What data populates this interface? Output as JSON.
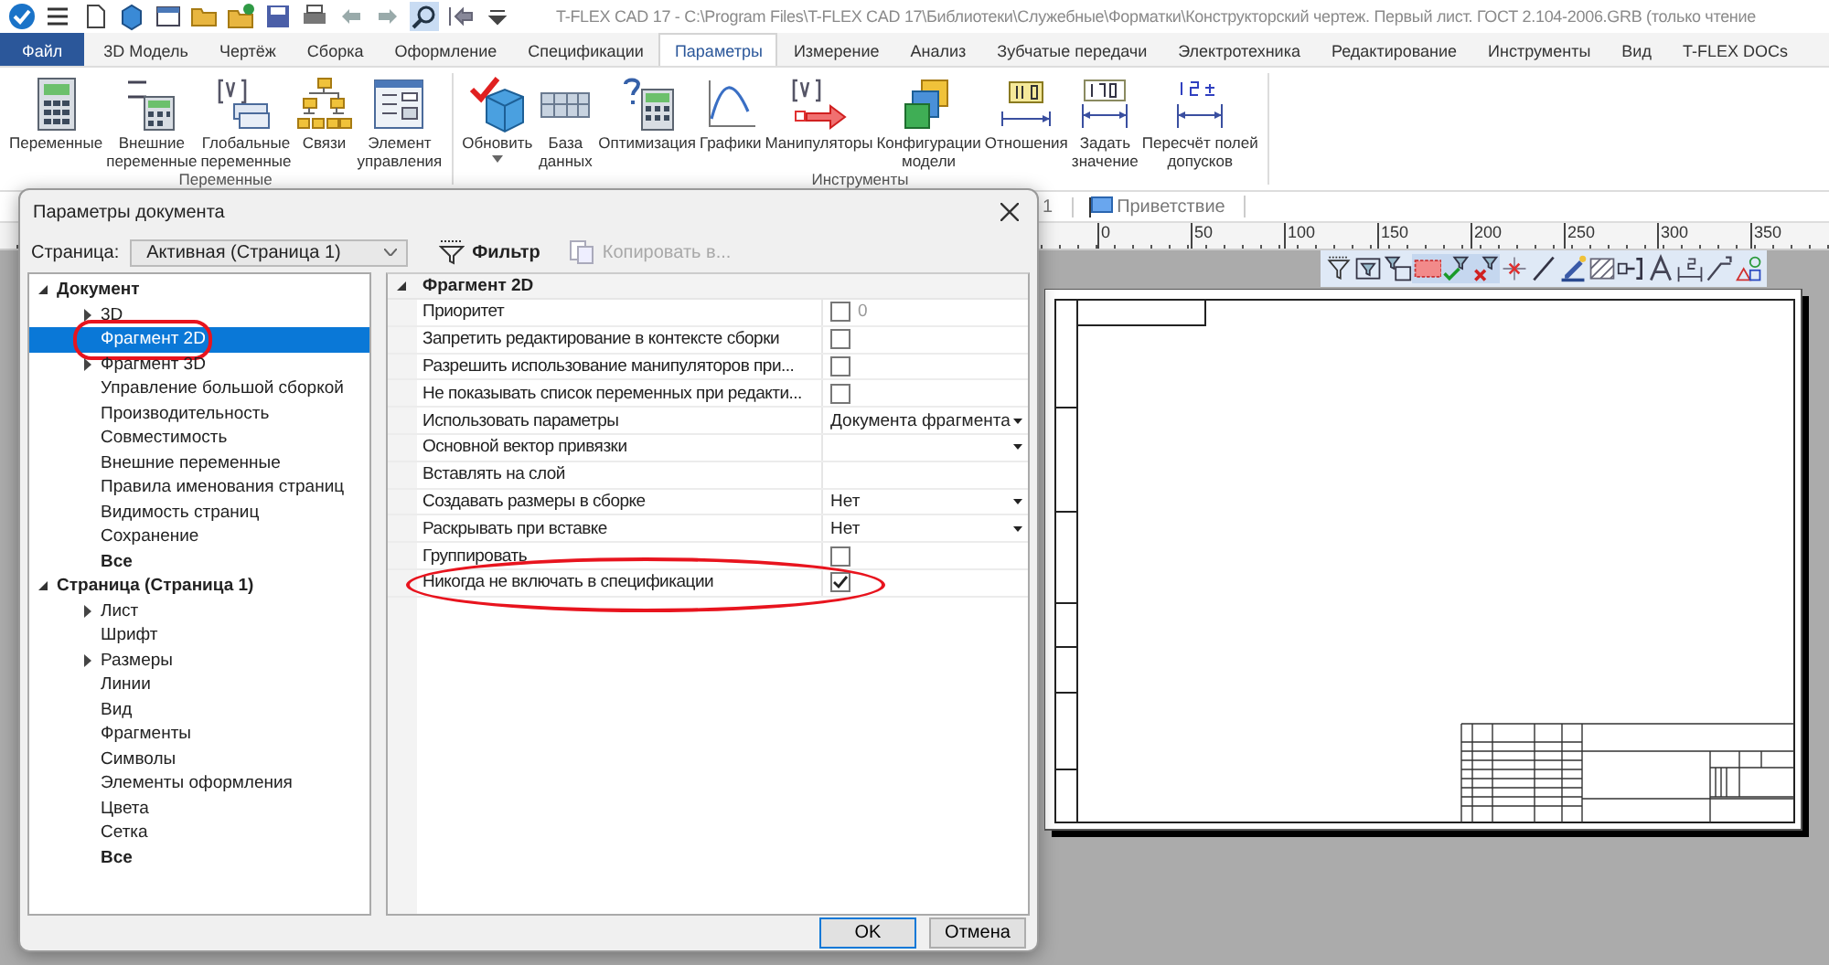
{
  "window": {
    "title": "T-FLEX CAD 17 - C:\\Program Files\\T-FLEX CAD 17\\Библиотеки\\Служебные\\Форматки\\Конструкторский чертеж. Первый лист. ГОСТ 2.104-2006.GRB (только чтение"
  },
  "tabs": [
    {
      "label": "Файл",
      "kind": "file",
      "selected": false
    },
    {
      "label": "3D Модель",
      "kind": "tab",
      "selected": false
    },
    {
      "label": "Чертёж",
      "kind": "tab",
      "selected": false
    },
    {
      "label": "Сборка",
      "kind": "tab",
      "selected": false
    },
    {
      "label": "Оформление",
      "kind": "tab",
      "selected": false
    },
    {
      "label": "Спецификации",
      "kind": "tab",
      "selected": false
    },
    {
      "label": "Параметры",
      "kind": "tab",
      "selected": true
    },
    {
      "label": "Измерение",
      "kind": "tab",
      "selected": false
    },
    {
      "label": "Анализ",
      "kind": "tab",
      "selected": false
    },
    {
      "label": "Зубчатые передачи",
      "kind": "tab",
      "selected": false
    },
    {
      "label": "Электротехника",
      "kind": "tab",
      "selected": false
    },
    {
      "label": "Редактирование",
      "kind": "tab",
      "selected": false
    },
    {
      "label": "Инструменты",
      "kind": "tab",
      "selected": false
    },
    {
      "label": "Вид",
      "kind": "tab",
      "selected": false
    },
    {
      "label": "T-FLEX DOCs",
      "kind": "tab",
      "selected": false
    }
  ],
  "ribbon": {
    "groups": [
      {
        "label": "Переменные",
        "buttons": [
          {
            "label": "Переменные",
            "dropdown": false
          },
          {
            "label": "Внешние\nпеременные",
            "dropdown": false
          },
          {
            "label": "Глобальные\nпеременные",
            "dropdown": false
          },
          {
            "label": "Связи",
            "dropdown": false
          },
          {
            "label": "Элемент\nуправления",
            "dropdown": false
          }
        ]
      },
      {
        "label": "Инструменты",
        "buttons": [
          {
            "label": "Обновить",
            "dropdown": true
          },
          {
            "label": "База\nданных",
            "dropdown": false
          },
          {
            "label": "Оптимизация",
            "dropdown": false
          },
          {
            "label": "Графики",
            "dropdown": false
          },
          {
            "label": "Манипуляторы",
            "dropdown": false
          },
          {
            "label": "Конфигурации\nмодели",
            "dropdown": false
          },
          {
            "label": "Отношения",
            "dropdown": false
          },
          {
            "label": "Задать\nзначение",
            "dropdown": false
          },
          {
            "label": "Пересчёт полей\nдопусков",
            "dropdown": false
          }
        ]
      }
    ]
  },
  "document_tabs": [
    {
      "label": "1"
    },
    {
      "label": "Приветствие"
    }
  ],
  "ruler": {
    "labels": [
      "0",
      "50",
      "100",
      "150",
      "200",
      "250",
      "300",
      "350"
    ]
  },
  "dialog": {
    "title": "Параметры документа",
    "page_label": "Страница:",
    "page_combo": {
      "value": "Активная (Страница 1)"
    },
    "toolbar": [
      {
        "label": "Фильтр",
        "disabled": false
      },
      {
        "label": "Копировать в...",
        "disabled": true
      }
    ],
    "tree": [
      {
        "label": "Документ",
        "expanded": true,
        "selected": false,
        "circled": false,
        "bold": true,
        "children": [
          {
            "label": "3D",
            "expanded": false,
            "selected": false,
            "circled": false,
            "bold": false
          },
          {
            "label": "Фрагмент 2D",
            "selected": true,
            "circled": true,
            "bold": false
          },
          {
            "label": "Фрагмент 3D",
            "expanded": false,
            "selected": false,
            "circled": false,
            "bold": false
          },
          {
            "label": "Управление большой сборкой",
            "selected": false,
            "circled": false,
            "bold": false
          },
          {
            "label": "Производительность",
            "selected": false,
            "circled": false,
            "bold": false
          },
          {
            "label": "Совместимость",
            "selected": false,
            "circled": false,
            "bold": false
          },
          {
            "label": "Внешние переменные",
            "selected": false,
            "circled": false,
            "bold": false
          },
          {
            "label": "Правила именования страниц",
            "selected": false,
            "circled": false,
            "bold": false
          },
          {
            "label": "Видимость страниц",
            "selected": false,
            "circled": false,
            "bold": false
          },
          {
            "label": "Сохранение",
            "selected": false,
            "circled": false,
            "bold": false
          },
          {
            "label": "Все",
            "selected": false,
            "circled": false,
            "bold": true
          }
        ]
      },
      {
        "label": "Страница (Страница 1)",
        "expanded": true,
        "selected": false,
        "circled": false,
        "bold": true,
        "children": [
          {
            "label": "Лист",
            "expanded": false,
            "selected": false,
            "circled": false,
            "bold": false
          },
          {
            "label": "Шрифт",
            "selected": false,
            "circled": false,
            "bold": false
          },
          {
            "label": "Размеры",
            "expanded": false,
            "selected": false,
            "circled": false,
            "bold": false
          },
          {
            "label": "Линии",
            "selected": false,
            "circled": false,
            "bold": false
          },
          {
            "label": "Вид",
            "selected": false,
            "circled": false,
            "bold": false
          },
          {
            "label": "Фрагменты",
            "selected": false,
            "circled": false,
            "bold": false
          },
          {
            "label": "Символы",
            "selected": false,
            "circled": false,
            "bold": false
          },
          {
            "label": "Элементы оформления",
            "selected": false,
            "circled": false,
            "bold": false
          },
          {
            "label": "Цвета",
            "selected": false,
            "circled": false,
            "bold": false
          },
          {
            "label": "Сетка",
            "selected": false,
            "circled": false,
            "bold": false
          },
          {
            "label": "Все",
            "selected": false,
            "circled": false,
            "bold": true
          }
        ]
      }
    ],
    "grid": {
      "section": {
        "label": "Фрагмент 2D",
        "expanded": true
      },
      "rows": [
        {
          "name": "Приоритет",
          "kind": "checkbox",
          "checked": false,
          "value": "0",
          "circled": false
        },
        {
          "name": "Запретить редактирование в контексте сборки",
          "kind": "checkbox",
          "checked": false,
          "circled": false
        },
        {
          "name": "Разрешить использование манипуляторов при...",
          "kind": "checkbox",
          "checked": false,
          "circled": false
        },
        {
          "name": "Не показывать список переменных при редакти...",
          "kind": "checkbox",
          "checked": false,
          "circled": false
        },
        {
          "name": "Использовать параметры",
          "kind": "dropdown",
          "value": "Документа фрагмента",
          "circled": false
        },
        {
          "name": "Основной вектор привязки",
          "kind": "dropdown",
          "circled": false
        },
        {
          "name": "Вставлять на слой",
          "kind": "text",
          "circled": false
        },
        {
          "name": "Создавать размеры в сборке",
          "kind": "dropdown",
          "value": "Нет",
          "circled": false
        },
        {
          "name": "Раскрывать при вставке",
          "kind": "dropdown",
          "value": "Нет",
          "circled": false
        },
        {
          "name": "Группировать",
          "kind": "checkbox",
          "checked": false,
          "circled": false
        },
        {
          "name": "Никогда не включать в спецификации",
          "kind": "checkbox",
          "checked": true,
          "circled": true
        }
      ]
    },
    "buttons": [
      {
        "label": "OK",
        "default": true
      },
      {
        "label": "Отмена",
        "default": false
      }
    ]
  }
}
